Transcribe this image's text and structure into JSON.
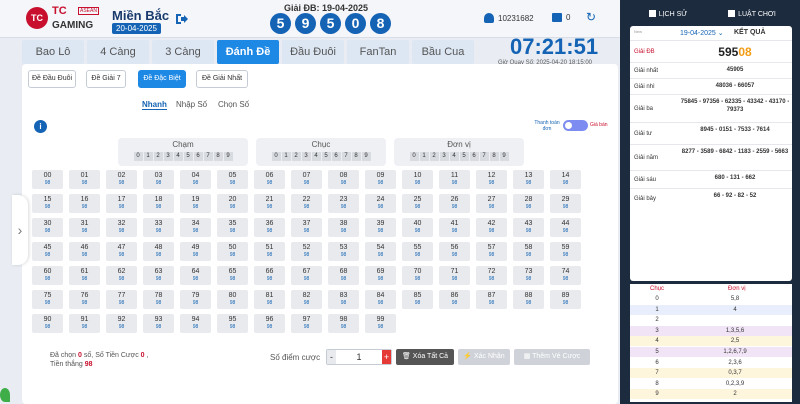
{
  "header": {
    "logo_text": "TC",
    "brand_line1": "TC",
    "brand_line2": "GAMING",
    "brand_tag": "ASEAN",
    "region": "Miền Bắc",
    "region_date": "20-04-2025",
    "prize_label": "Giải ĐB: 19-04-2025",
    "balls": [
      "5",
      "9",
      "5",
      "0",
      "8"
    ],
    "user_id": "10231682",
    "balance": "0"
  },
  "tabs": [
    {
      "label": "Bao Lô"
    },
    {
      "label": "4 Càng"
    },
    {
      "label": "3 Càng"
    },
    {
      "label": "Đánh Đề",
      "active": true
    },
    {
      "label": "Đầu Đuôi"
    },
    {
      "label": "FanTan"
    },
    {
      "label": "Bầu Cua"
    }
  ],
  "clock": {
    "time": "07:21:51",
    "draw_time": "Giờ Quay Số: 2025-04-20 18:15:00"
  },
  "subtabs": [
    {
      "label": "Đề Đầu Đuôi"
    },
    {
      "label": "Đề Giải 7"
    },
    {
      "label": "Đề Đặc Biệt",
      "active": true
    },
    {
      "label": "Đề Giải Nhất"
    }
  ],
  "modes": [
    {
      "label": "Nhanh",
      "active": true
    },
    {
      "label": "Nhập Số"
    },
    {
      "label": "Chọn Số"
    }
  ],
  "info_icon_text": "i",
  "toggle": {
    "left_label": "Thanh toán đơn",
    "right_label": "Giá bán"
  },
  "groups": [
    {
      "title": "Chạm",
      "digits": [
        "0",
        "1",
        "2",
        "3",
        "4",
        "5",
        "6",
        "7",
        "8",
        "9"
      ]
    },
    {
      "title": "Chục",
      "digits": [
        "0",
        "1",
        "2",
        "3",
        "4",
        "5",
        "6",
        "7",
        "8",
        "9"
      ]
    },
    {
      "title": "Đơn vị",
      "digits": [
        "0",
        "1",
        "2",
        "3",
        "4",
        "5",
        "6",
        "7",
        "8",
        "9"
      ]
    }
  ],
  "odds": "98",
  "numbers": [
    "00",
    "01",
    "02",
    "03",
    "04",
    "05",
    "06",
    "07",
    "08",
    "09",
    "10",
    "11",
    "12",
    "13",
    "14",
    "15",
    "16",
    "17",
    "18",
    "19",
    "20",
    "21",
    "22",
    "23",
    "24",
    "25",
    "26",
    "27",
    "28",
    "29",
    "30",
    "31",
    "32",
    "33",
    "34",
    "35",
    "36",
    "37",
    "38",
    "39",
    "40",
    "41",
    "42",
    "43",
    "44",
    "45",
    "46",
    "47",
    "48",
    "49",
    "50",
    "51",
    "52",
    "53",
    "54",
    "55",
    "56",
    "57",
    "58",
    "59",
    "60",
    "61",
    "62",
    "63",
    "64",
    "65",
    "66",
    "67",
    "68",
    "69",
    "70",
    "71",
    "72",
    "73",
    "74",
    "75",
    "76",
    "77",
    "78",
    "79",
    "80",
    "81",
    "82",
    "83",
    "84",
    "85",
    "86",
    "87",
    "88",
    "89",
    "90",
    "91",
    "92",
    "93",
    "94",
    "95",
    "96",
    "97",
    "98",
    "99"
  ],
  "footer": {
    "selected_label": "Đã chọn",
    "selected_value": "0",
    "selected_unit": "số,",
    "bet_label": "Số Tiền Cược",
    "bet_value": "0",
    "win_label": "Tiền thắng",
    "win_value": "98",
    "points_label": "Số điểm cược",
    "points_value": "1",
    "minus": "-",
    "plus": "+",
    "delete_label": "Xóa Tất Cả",
    "confirm_label": "Xác Nhận",
    "add_label": "Thêm Vé Cược"
  },
  "results": {
    "tab_history": "LỊCH SỬ",
    "tab_rules": "LUẬT CHƠI",
    "new_tag": "New",
    "date": "19-04-2025",
    "title": "KẾT QUẢ",
    "db_label": "Giải ĐB",
    "db_main": "595",
    "db_highlight": "08",
    "rows": [
      {
        "label": "Giải nhất",
        "value": "45905"
      },
      {
        "label": "Giải nhì",
        "value": "48036 - 66057"
      },
      {
        "label": "Giải ba",
        "value": "75845 - 97356 - 62335 - 43342 - 43170 - 79373"
      },
      {
        "label": "Giải tư",
        "value": "8945 - 0151 - 7533 - 7614"
      },
      {
        "label": "Giải năm",
        "value": "8277 - 3589 - 6842 - 1183 - 2559 - 5663"
      },
      {
        "label": "Giải sáu",
        "value": "680 - 131 - 662"
      },
      {
        "label": "Giải bảy",
        "value": "66 - 92 - 82 - 52"
      }
    ],
    "loto_head_tens": "Chục",
    "loto_head_units": "Đơn vị",
    "loto": [
      {
        "c": "0",
        "d": "5,8"
      },
      {
        "c": "1",
        "d": "4"
      },
      {
        "c": "2",
        "d": ""
      },
      {
        "c": "3",
        "d": "1,3,5,6"
      },
      {
        "c": "4",
        "d": "2,5"
      },
      {
        "c": "5",
        "d": "1,2,6,7,9"
      },
      {
        "c": "6",
        "d": "2,3,6"
      },
      {
        "c": "7",
        "d": "0,3,7"
      },
      {
        "c": "8",
        "d": "0,2,3,9"
      },
      {
        "c": "9",
        "d": "2"
      }
    ]
  }
}
